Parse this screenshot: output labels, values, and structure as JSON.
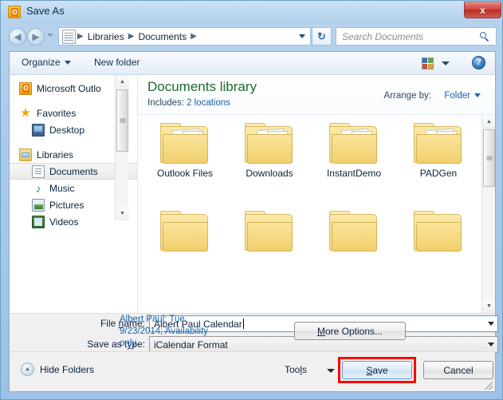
{
  "window": {
    "title": "Save As",
    "app_icon": "outlook-icon",
    "close_label": "x",
    "accent_blue": "#5c9ccc",
    "annotation_color": "#ff0000"
  },
  "navbar": {
    "back_glyph": "◀",
    "forward_glyph": "▶",
    "breadcrumbs": [
      "Libraries",
      "Documents"
    ],
    "separator": "▶",
    "refresh_glyph": "↻",
    "search": {
      "placeholder": "Search Documents",
      "value": ""
    }
  },
  "toolbar": {
    "organize_label": "Organize",
    "new_folder_label": "New folder",
    "view_icon": "view-layout-icon",
    "help_label": "?"
  },
  "sidebar": {
    "items": [
      {
        "label": "Microsoft Outlo",
        "icon": "outlook-icon",
        "level": "root",
        "selected": false
      },
      {
        "label": "Favorites",
        "icon": "star-icon",
        "level": "root",
        "selected": false
      },
      {
        "label": "Desktop",
        "icon": "desktop-icon",
        "level": "child",
        "selected": false
      },
      {
        "label": "Libraries",
        "icon": "library-icon",
        "level": "root",
        "selected": false
      },
      {
        "label": "Documents",
        "icon": "document-icon",
        "level": "child",
        "selected": true
      },
      {
        "label": "Music",
        "icon": "music-icon",
        "level": "child",
        "selected": false
      },
      {
        "label": "Pictures",
        "icon": "pictures-icon",
        "level": "child",
        "selected": false
      },
      {
        "label": "Videos",
        "icon": "videos-icon",
        "level": "child",
        "selected": false
      }
    ]
  },
  "library": {
    "title": "Documents library",
    "includes_label": "Includes:",
    "includes_value": "2 locations",
    "arrange_label": "Arrange by:",
    "arrange_value": "Folder"
  },
  "files": {
    "row1": [
      {
        "name": "Outlook Files",
        "icon": "folder-icon"
      },
      {
        "name": "Downloads",
        "icon": "folder-icon"
      },
      {
        "name": "InstantDemo",
        "icon": "folder-icon"
      },
      {
        "name": "PADGen",
        "icon": "folder-icon"
      }
    ],
    "row2": [
      {
        "name": "",
        "icon": "folder-icon"
      },
      {
        "name": "",
        "icon": "folder-icon"
      },
      {
        "name": "",
        "icon": "folder-icon"
      },
      {
        "name": "",
        "icon": "folder-icon"
      }
    ]
  },
  "form": {
    "file_name_label_pre": "File ",
    "file_name_label_acc": "n",
    "file_name_label_post": "ame:",
    "file_name_value": "Albert Paul Calendar",
    "save_type_label_pre": "Save as t",
    "save_type_label_acc": "y",
    "save_type_label_post": "pe:",
    "save_type_value": "iCalendar Format"
  },
  "options": {
    "note_text": "Albert Paul; Tue 9/23/2014; Availability only",
    "more_options_pre": "",
    "more_options_acc": "M",
    "more_options_post": "ore Options..."
  },
  "bottom": {
    "hide_folders_label": "Hide Folders",
    "hide_folders_glyph": "▲",
    "tools_pre": "Too",
    "tools_acc": "l",
    "tools_post": "s",
    "save_pre": "",
    "save_acc": "S",
    "save_post": "ave",
    "cancel_label": "Cancel"
  }
}
